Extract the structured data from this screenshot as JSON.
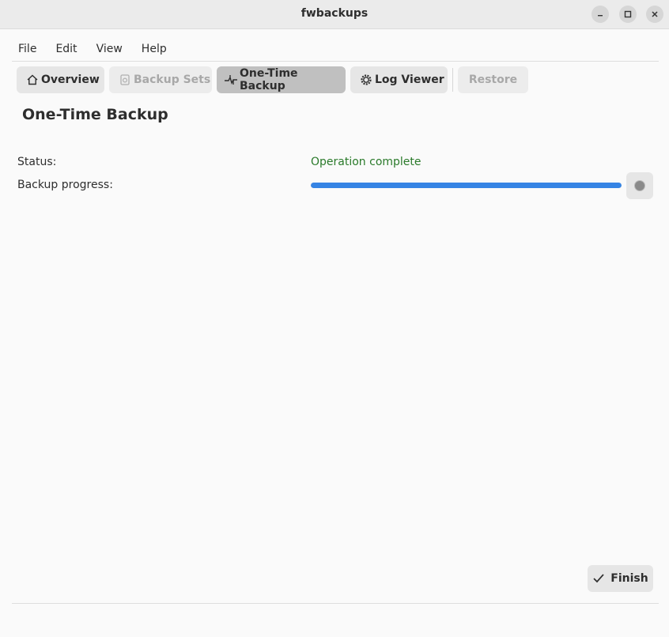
{
  "window": {
    "title": "fwbackups",
    "controls": [
      "minimize-icon",
      "maximize-icon",
      "close-icon"
    ]
  },
  "menu": {
    "items": [
      {
        "label": "File"
      },
      {
        "label": "Edit"
      },
      {
        "label": "View"
      },
      {
        "label": "Help"
      }
    ]
  },
  "toolbar": {
    "overview": {
      "label": "Overview",
      "icon": "home-icon",
      "state": "normal"
    },
    "backup_sets": {
      "label": "Backup Sets",
      "icon": "backup-sets-icon",
      "state": "disabled"
    },
    "one_time_backup": {
      "label": "One-Time Backup",
      "icon": "one-time-backup-icon",
      "state": "active"
    },
    "log_viewer": {
      "label": "Log Viewer",
      "icon": "gear-icon",
      "state": "normal"
    },
    "restore": {
      "label": "Restore",
      "state": "disabled"
    }
  },
  "page": {
    "title": "One-Time Backup",
    "status_label": "Status:",
    "status_value": "Operation complete",
    "status_color": "#2a7a2a",
    "progress_label": "Backup progress:",
    "progress_fraction": 1.0,
    "progress_color": "#3584e4"
  },
  "actions": {
    "finish_label": "Finish",
    "finish_icon": "checkmark-icon",
    "stop_icon": "stop-icon"
  }
}
